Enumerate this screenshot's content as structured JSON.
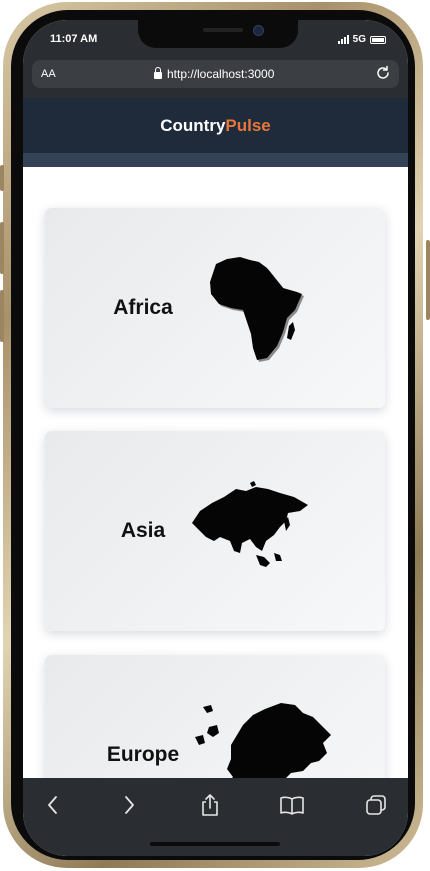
{
  "status_bar": {
    "time": "11:07 AM",
    "network": "5G"
  },
  "browser": {
    "aa_label": "AA",
    "url": "http://localhost:3000"
  },
  "app": {
    "brand_primary": "Country",
    "brand_accent": "Pulse",
    "accent_color": "#e8763a",
    "header_color": "#1f2a3b"
  },
  "continents": [
    {
      "name": "Africa",
      "icon": "africa-map"
    },
    {
      "name": "Asia",
      "icon": "asia-map"
    },
    {
      "name": "Europe",
      "icon": "europe-map"
    }
  ],
  "toolbar": {
    "icons": [
      "back-icon",
      "forward-icon",
      "share-icon",
      "bookmarks-icon",
      "tabs-icon"
    ]
  }
}
